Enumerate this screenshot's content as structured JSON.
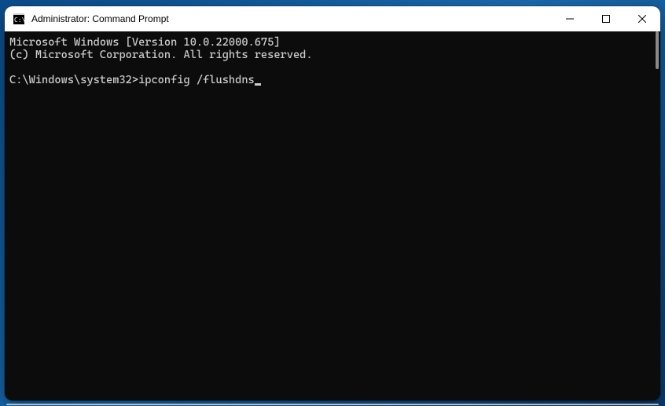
{
  "window": {
    "title": "Administrator: Command Prompt",
    "icon_name": "cmd-icon"
  },
  "controls": {
    "minimize": "Minimize",
    "maximize": "Maximize",
    "close": "Close"
  },
  "terminal": {
    "banner_version": "Microsoft Windows [Version 10.0.22000.675]",
    "banner_copyright": "(c) Microsoft Corporation. All rights reserved.",
    "prompt": "C:\\Windows\\system32>",
    "command": "ipconfig /flushdns"
  }
}
